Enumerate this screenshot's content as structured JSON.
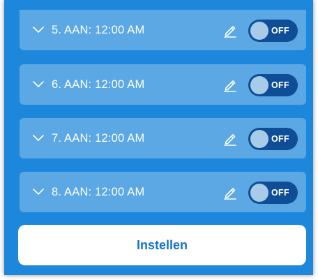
{
  "colors": {
    "panel": "#1d87dc",
    "row": "rgba(255,255,255,0.28)",
    "toggle_track": "#0f4e96",
    "toggle_knob": "#a7cbe9",
    "button_text": "#1673c9"
  },
  "icons": {
    "expand": "chevron-down-icon",
    "edit": "pencil-icon"
  },
  "alarms": [
    {
      "label": "5. AAN: 12:00 AM",
      "toggle": "OFF"
    },
    {
      "label": "6. AAN: 12:00 AM",
      "toggle": "OFF"
    },
    {
      "label": "7. AAN: 12:00 AM",
      "toggle": "OFF"
    },
    {
      "label": "8. AAN: 12:00 AM",
      "toggle": "OFF"
    }
  ],
  "footer": {
    "button_label": "Instellen"
  }
}
